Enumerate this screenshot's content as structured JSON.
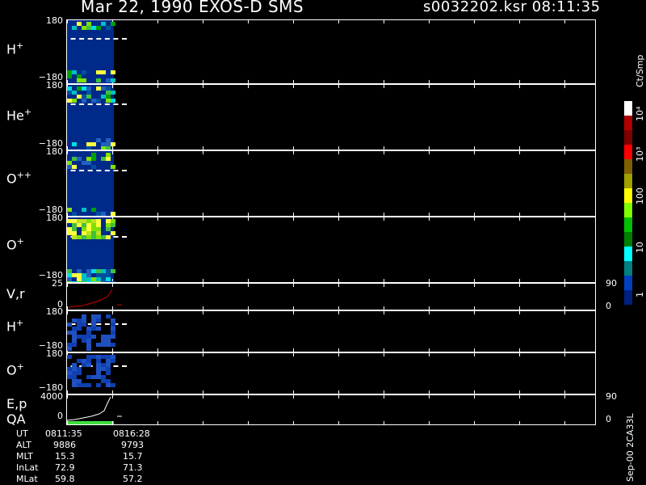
{
  "header": {
    "date_title": "Mar 22, 1990   EXOS-D SMS",
    "file_time": "s0032202.ksr  08:11:35"
  },
  "panels": {
    "h_plus": {
      "label": "H",
      "sup": "+",
      "top": "180",
      "bottom": "−180"
    },
    "he_plus": {
      "label": "He",
      "sup": "+",
      "top": "180",
      "bottom": "−180"
    },
    "o_plus_plus": {
      "label": "O",
      "sup": "++",
      "top": "180",
      "bottom": "−180"
    },
    "o_plus": {
      "label": "O",
      "sup": "+",
      "top": "180",
      "bottom": "−180"
    },
    "vr": {
      "label": "V,r",
      "top": "25",
      "bottom": "0",
      "rtop": "90",
      "rbottom": "0"
    },
    "h_plus2": {
      "label": "H",
      "sup": "+",
      "top": "180",
      "bottom": "−180"
    },
    "o_plus2": {
      "label": "O",
      "sup": "+",
      "top": "180",
      "bottom": "−180"
    },
    "ep": {
      "label1": "E,p",
      "label2": "QA",
      "top": "4000",
      "bottom": "0",
      "rtop": "90",
      "rbottom": "0"
    }
  },
  "colorbar": {
    "unit": "Ct/Smp",
    "labels": [
      "10⁴",
      "10³",
      "100",
      "10",
      "1"
    ],
    "colors": [
      "#ffffff",
      "#b00000",
      "#800000",
      "#ff0000",
      "#806000",
      "#a0a000",
      "#ffff00",
      "#80ff00",
      "#00c000",
      "#008000",
      "#00ffff",
      "#008080",
      "#0040c0",
      "#002080"
    ]
  },
  "info": {
    "rows": [
      {
        "label": "UT",
        "v1": "0811:35",
        "v2": "0816:28"
      },
      {
        "label": "ALT",
        "v1": "9886",
        "v2": "9793"
      },
      {
        "label": "MLT",
        "v1": "15.3",
        "v2": "15.7"
      },
      {
        "label": "InLat",
        "v1": "72.9",
        "v2": "71.3"
      },
      {
        "label": "MLat",
        "v1": "59.8",
        "v2": "57.2"
      }
    ]
  },
  "footer": {
    "vertical": "Sep-00  2CA33L"
  }
}
